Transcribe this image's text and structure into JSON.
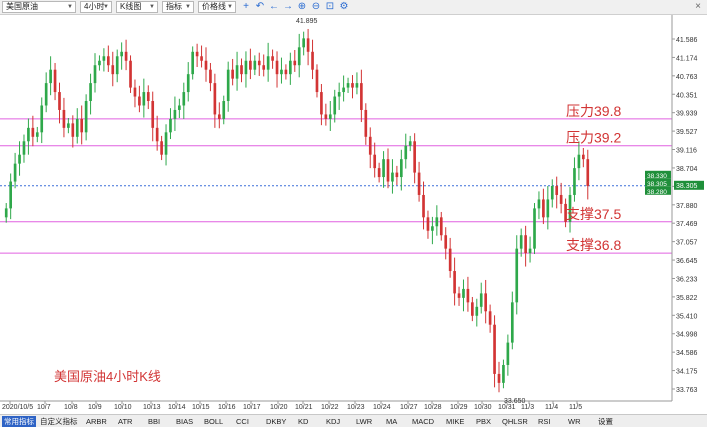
{
  "toolbar": {
    "instrument": "美国原油",
    "period": "4小时",
    "chart_style": "K线图",
    "indicator": "指标",
    "price_line": "价格线",
    "icons": [
      "add-icon",
      "back-icon",
      "left-arrow-icon",
      "right-arrow-icon",
      "zoom-in-icon",
      "zoom-out-icon",
      "fit-icon",
      "settings-icon"
    ],
    "close_label": "×"
  },
  "chart_data": {
    "type": "candlestick",
    "title": "美国原油4小时K线",
    "y_ticks": [
      "41.586",
      "41.174",
      "40.763",
      "40.351",
      "39.939",
      "39.527",
      "39.116",
      "38.704",
      "38.292",
      "37.880",
      "37.469",
      "37.057",
      "36.645",
      "36.233",
      "35.822",
      "35.410",
      "34.998",
      "34.586",
      "34.175",
      "33.763"
    ],
    "ylim": [
      33.5,
      42.2
    ],
    "x_ticks": [
      "2020/10/5",
      "10/7",
      "10/8",
      "10/9",
      "10/10",
      "10/13",
      "10/14",
      "10/15",
      "10/16",
      "10/17",
      "10/20",
      "10/21",
      "10/22",
      "10/23",
      "10/24",
      "10/27",
      "10/28",
      "10/29",
      "10/30",
      "10/31",
      "11/3",
      "11/4",
      "11/5"
    ],
    "high_label": "41.895",
    "low_label": "33.650",
    "high_value": 41.895,
    "low_value": 33.65,
    "price_badges": [
      "38.330",
      "38.305",
      "38.280"
    ],
    "last_price": 38.305,
    "levels": [
      {
        "label": "压力39.8",
        "value": 39.8
      },
      {
        "label": "压力39.2",
        "value": 39.2
      },
      {
        "label": "支撑37.5",
        "value": 37.5
      },
      {
        "label": "支撑36.8",
        "value": 36.8
      }
    ],
    "colors": {
      "up": "#2ea84a",
      "down": "#d23434",
      "level": "#e060e0",
      "price_line": "#3a6fd8",
      "annotation": "#d23434"
    },
    "closes": [
      37.8,
      38.4,
      38.8,
      39.0,
      39.3,
      39.6,
      39.4,
      39.5,
      40.1,
      40.6,
      40.9,
      40.4,
      40.0,
      39.6,
      39.7,
      39.4,
      39.8,
      39.5,
      40.2,
      40.6,
      41.0,
      41.1,
      41.2,
      41.0,
      40.8,
      41.2,
      41.3,
      41.1,
      40.5,
      40.3,
      40.1,
      40.4,
      40.2,
      39.6,
      39.3,
      39.0,
      39.5,
      39.8,
      40.0,
      40.1,
      40.4,
      40.8,
      41.3,
      41.2,
      41.1,
      40.9,
      40.6,
      39.9,
      39.8,
      40.2,
      40.9,
      40.7,
      41.0,
      40.8,
      41.1,
      40.9,
      41.1,
      41.0,
      40.9,
      41.2,
      41.1,
      40.8,
      40.9,
      40.8,
      41.1,
      41.0,
      41.4,
      41.6,
      41.3,
      40.9,
      40.4,
      39.9,
      39.8,
      39.9,
      40.3,
      40.4,
      40.5,
      40.6,
      40.5,
      40.6,
      40.0,
      39.4,
      39.0,
      38.7,
      38.5,
      38.9,
      38.4,
      38.6,
      38.5,
      38.9,
      39.2,
      39.3,
      38.6,
      38.1,
      37.6,
      37.3,
      37.4,
      37.6,
      37.2,
      36.9,
      36.4,
      35.9,
      35.8,
      36.0,
      35.7,
      35.4,
      35.6,
      35.9,
      35.5,
      35.2,
      34.1,
      33.9,
      34.3,
      34.8,
      35.7,
      36.9,
      37.2,
      36.8,
      36.9,
      37.8,
      38.0,
      37.6,
      38.0,
      38.3,
      38.1,
      37.9,
      37.5,
      38.1,
      38.7,
      39.0,
      38.9,
      38.3
    ],
    "legend": []
  },
  "bottom": {
    "tabs": [
      "常用指标",
      "自定义指标",
      "ARBR",
      "ATR",
      "BBI",
      "BIAS",
      "BOLL",
      "CCI",
      "DKBY",
      "KD",
      "KDJ",
      "LWR",
      "MA",
      "MACD",
      "MIKE",
      "PBX",
      "QHLSR",
      "RSI",
      "WR",
      "设置"
    ]
  }
}
